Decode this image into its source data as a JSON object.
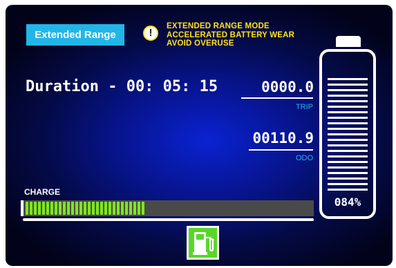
{
  "mode": {
    "label": "Extended Range"
  },
  "warning": {
    "icon": "exclamation-circle-icon",
    "lines": [
      "EXTENDED RANGE MODE",
      "ACCELERATED BATTERY WEAR",
      "AVOID OVERUSE"
    ],
    "color": "#ffe21a"
  },
  "duration": {
    "text": "Duration - 00: 05: 15"
  },
  "trip": {
    "value": "0000.0",
    "label": "TRIP"
  },
  "odo": {
    "value": "00110.9",
    "label": "ODO"
  },
  "charge": {
    "label": "CHARGE",
    "level": 0.42,
    "fill_color": "#7ce81c"
  },
  "battery": {
    "percent_text": "084%",
    "level": 0.84
  },
  "fuel_button": {
    "icon": "fuel-pump-icon",
    "color": "#59d62a"
  }
}
